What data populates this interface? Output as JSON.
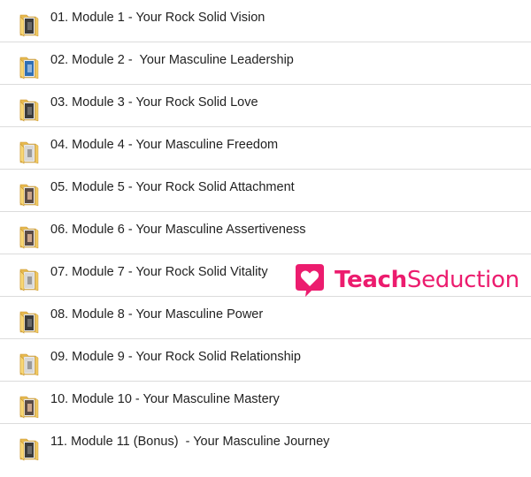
{
  "folders": [
    {
      "label": "01. Module 1 - Your Rock Solid Vision",
      "icon": "folder-icon",
      "thumb": "dark"
    },
    {
      "label": "02. Module 2 -  Your Masculine Leadership",
      "icon": "folder-icon",
      "thumb": "blue"
    },
    {
      "label": "03. Module 3 - Your Rock Solid Love",
      "icon": "folder-icon",
      "thumb": "dark"
    },
    {
      "label": "04. Module 4 - Your Masculine Freedom",
      "icon": "folder-icon",
      "thumb": "light"
    },
    {
      "label": "05. Module 5 - Your Rock Solid Attachment",
      "icon": "folder-icon",
      "thumb": "person"
    },
    {
      "label": "06. Module 6 - Your Masculine Assertiveness",
      "icon": "folder-icon",
      "thumb": "person"
    },
    {
      "label": "07. Module 7 - Your Rock Solid Vitality",
      "icon": "folder-icon",
      "thumb": "light"
    },
    {
      "label": "08. Module 8 - Your Masculine Power",
      "icon": "folder-icon",
      "thumb": "dark"
    },
    {
      "label": "09. Module 9 - Your Rock Solid Relationship",
      "icon": "folder-icon",
      "thumb": "light"
    },
    {
      "label": "10. Module 10 - Your Masculine Mastery",
      "icon": "folder-icon",
      "thumb": "person"
    },
    {
      "label": "11. Module 11 (Bonus)  - Your Masculine Journey",
      "icon": "folder-icon",
      "thumb": "dark"
    }
  ],
  "watermark": {
    "part1": "Teach",
    "part2": "Seduction",
    "icon": "heart-chat-logo-icon",
    "color": "#ec1c6e"
  },
  "colors": {
    "folder_back": "#e7b94e",
    "folder_front": "#f8d775",
    "divider": "#dcdcdc"
  }
}
